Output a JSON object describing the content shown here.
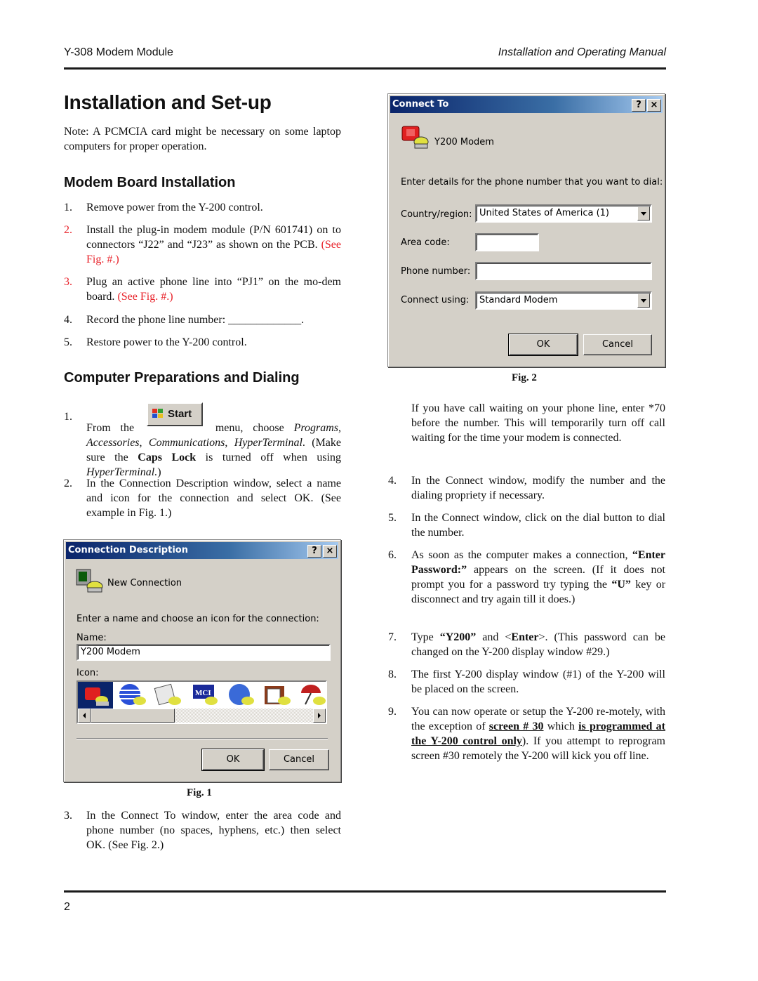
{
  "header": {
    "left": "Y-308 Modem Module",
    "right": "Installation and Operating Manual"
  },
  "page_number": "2",
  "title": "Installation and Set-up",
  "note": "Note: A PCMCIA card might be necessary on some laptop computers for proper operation.",
  "modem_board": {
    "heading": "Modem Board Installation",
    "steps": [
      {
        "num": "1.",
        "text": "Remove power from the Y-200 control."
      },
      {
        "num": "2.",
        "text": "Install the plug-in modem module (P/N 601741) on to connectors “J22” and “J23” as shown on the PCB.",
        "ref": "(See Fig. #.)"
      },
      {
        "num": "3.",
        "text": "Plug an active phone line into “PJ1” on the mo-dem board.",
        "ref": "(See Fig. #.)"
      },
      {
        "num": "4.",
        "text": "Record the phone line number: _____________."
      },
      {
        "num": "5.",
        "text": "Restore power to the Y-200 control."
      }
    ]
  },
  "computer_prep": {
    "heading": "Computer Preparations and Dialing",
    "step1": {
      "num": "1.",
      "pre": "From the",
      "start_label": "Start",
      "post": "menu, choose",
      "programs": "Programs",
      "accessories": "Accessories",
      "communications": "Communications",
      "hyperterminal": "HyperTerminal",
      "make_sure": "(Make sure the",
      "caps_lock": "Caps Lock",
      "turned_off": "is turned off when using",
      "hyperterminal2": "HyperTerminal.",
      "close": ")"
    },
    "step2": {
      "num": "2.",
      "text": "In the Connection Description window, select a name and icon for the connection and select OK. (See example in Fig. 1.)"
    },
    "step3": {
      "num": "3.",
      "text": "In the Connect To window, enter the area code and phone number (no spaces, hyphens, etc.) then select OK. (See Fig. 2.)"
    },
    "call_waiting": "If you have call waiting on your phone line, enter *70 before the number. This will temporarily turn off call waiting for the time your modem is connected.",
    "step4": {
      "num": "4.",
      "text": "In the Connect window, modify the number and the dialing propriety if necessary."
    },
    "step5": {
      "num": "5.",
      "text": "In the Connect window, click on the dial button to dial the number."
    },
    "step6": {
      "num": "6.",
      "pre": "As soon as the computer makes a connection,",
      "bold1": "“Enter Password:”",
      "mid": "appears on the screen. (If it does not prompt you for a password try typing the",
      "bold2": "“U”",
      "post": "key or disconnect and try again till it does.)"
    },
    "step7": {
      "num": "7.",
      "pre": "Type",
      "bold1": "“Y200”",
      "mid": "and <",
      "bold2": "Enter",
      "post": ">. (This password can be changed on the Y-200 display window #29.)"
    },
    "step8": {
      "num": "8.",
      "text": "The first Y-200 display window (#1) of the Y-200 will be placed on the screen."
    },
    "step9": {
      "num": "9.",
      "pre": "You can now operate or setup the Y-200 re-motely, with the exception of",
      "bold1": "screen # 30",
      "mid": "which",
      "bold2": "is programmed at the Y-200 control only",
      "post": "). If you attempt to reprogram screen #30 remotely the Y-200 will kick you off line."
    }
  },
  "fig1": {
    "caption": "Fig. 1",
    "title": "Connection Description",
    "help_btn": "?",
    "close_btn": "×",
    "connection_label": "New Connection",
    "instruction": "Enter a name and choose an icon for the connection:",
    "name_label": "Name:",
    "name_value": "Y200 Modem",
    "icon_label": "Icon:",
    "icons": [
      "red-phone-icon",
      "globe-icon",
      "newspaper-icon",
      "mci-icon",
      "ge-icon",
      "documents-icon",
      "umbrella-icon"
    ],
    "ok": "OK",
    "cancel": "Cancel"
  },
  "fig2": {
    "caption": "Fig. 2",
    "title": "Connect To",
    "help_btn": "?",
    "close_btn": "×",
    "connection_name": "Y200 Modem",
    "instruction": "Enter details for the phone number that you want to dial:",
    "country_label": "Country/region:",
    "country_value": "United States of America (1)",
    "area_label": "Area code:",
    "area_value": "",
    "phone_label": "Phone number:",
    "phone_value": "",
    "connect_label": "Connect using:",
    "connect_value": "Standard Modem",
    "ok": "OK",
    "cancel": "Cancel"
  }
}
